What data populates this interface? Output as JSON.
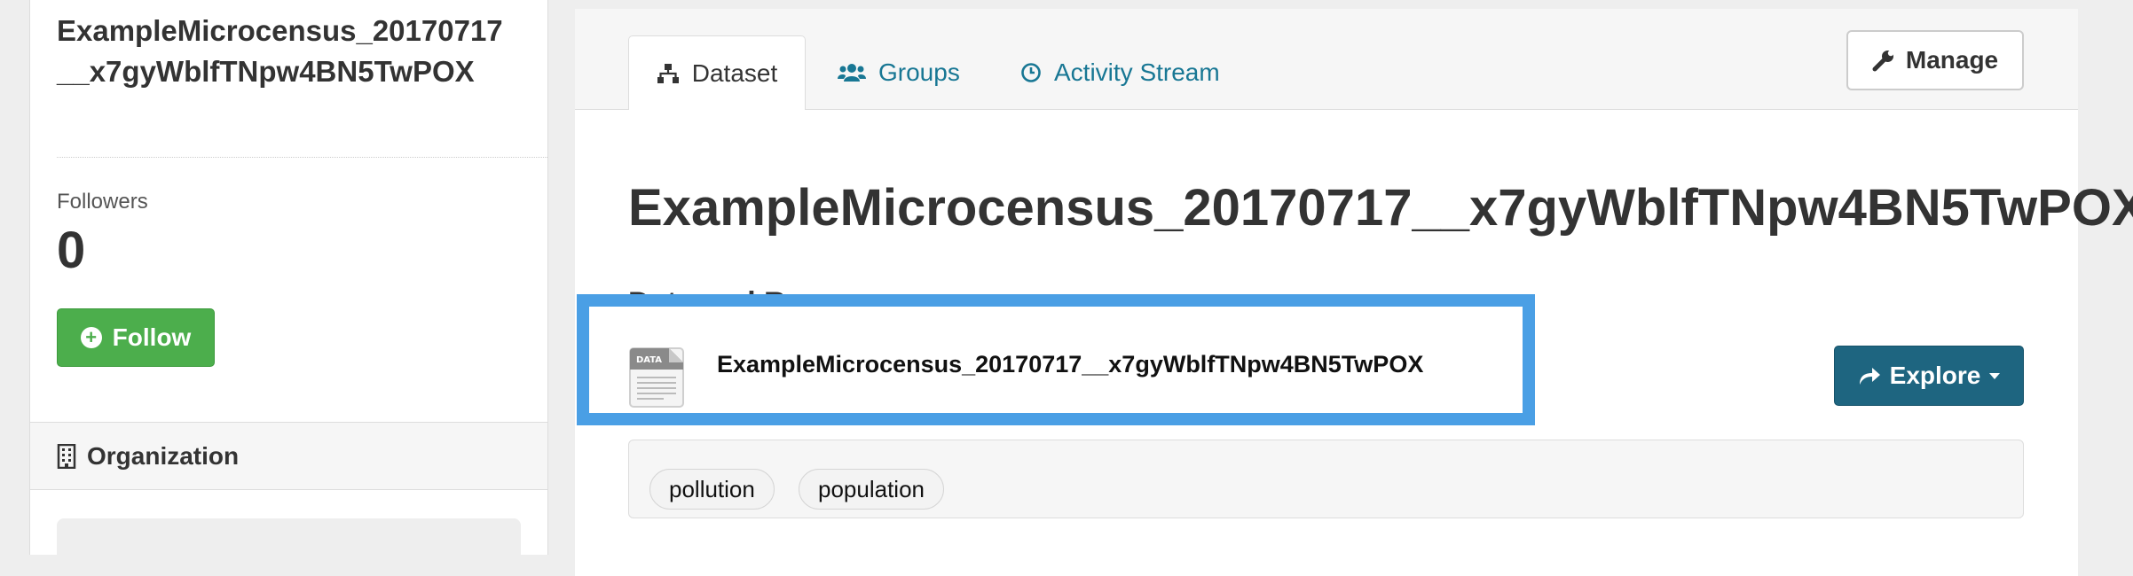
{
  "sidebar": {
    "dataset_name": "ExampleMicrocen­sus_20170717__x7gyWblfT­Npw4BN5TwPOX",
    "followers_label": "Followers",
    "followers_count": "0",
    "follow_label": "Follow",
    "organization_label": "Organization"
  },
  "tabs": {
    "dataset": "Dataset",
    "groups": "Groups",
    "activity": "Activity Stream"
  },
  "manage_label": "Manage",
  "dataset_title": "ExampleMicrocensus_20170717__x7gyWblfTNpw4BN5TwPOX",
  "resources": {
    "heading": "Data and Resources",
    "item_name": "ExampleMicrocensus_20170717__x7gyWblfTNpw4BN5TwPOX",
    "icon_label": "DATA",
    "explore_label": "Explore"
  },
  "tags": [
    "pollution",
    "population"
  ],
  "colors": {
    "follow_green": "#4cae4c",
    "link_blue": "#187794",
    "explore_teal": "#1e6580",
    "highlight_blue": "#4a9fe5"
  }
}
